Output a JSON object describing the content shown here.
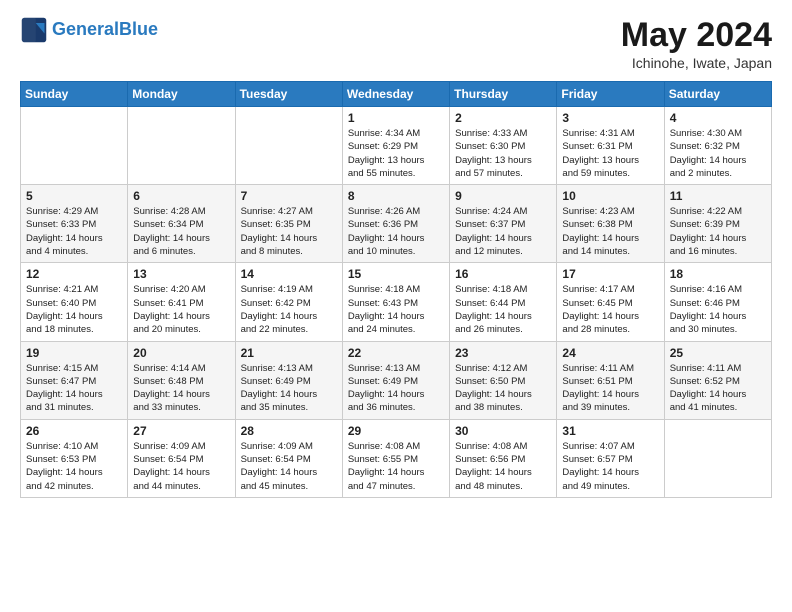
{
  "header": {
    "logo_line1": "General",
    "logo_line2": "Blue",
    "month": "May 2024",
    "location": "Ichinohe, Iwate, Japan"
  },
  "days_of_week": [
    "Sunday",
    "Monday",
    "Tuesday",
    "Wednesday",
    "Thursday",
    "Friday",
    "Saturday"
  ],
  "weeks": [
    [
      {
        "day": "",
        "info": ""
      },
      {
        "day": "",
        "info": ""
      },
      {
        "day": "",
        "info": ""
      },
      {
        "day": "1",
        "info": "Sunrise: 4:34 AM\nSunset: 6:29 PM\nDaylight: 13 hours\nand 55 minutes."
      },
      {
        "day": "2",
        "info": "Sunrise: 4:33 AM\nSunset: 6:30 PM\nDaylight: 13 hours\nand 57 minutes."
      },
      {
        "day": "3",
        "info": "Sunrise: 4:31 AM\nSunset: 6:31 PM\nDaylight: 13 hours\nand 59 minutes."
      },
      {
        "day": "4",
        "info": "Sunrise: 4:30 AM\nSunset: 6:32 PM\nDaylight: 14 hours\nand 2 minutes."
      }
    ],
    [
      {
        "day": "5",
        "info": "Sunrise: 4:29 AM\nSunset: 6:33 PM\nDaylight: 14 hours\nand 4 minutes."
      },
      {
        "day": "6",
        "info": "Sunrise: 4:28 AM\nSunset: 6:34 PM\nDaylight: 14 hours\nand 6 minutes."
      },
      {
        "day": "7",
        "info": "Sunrise: 4:27 AM\nSunset: 6:35 PM\nDaylight: 14 hours\nand 8 minutes."
      },
      {
        "day": "8",
        "info": "Sunrise: 4:26 AM\nSunset: 6:36 PM\nDaylight: 14 hours\nand 10 minutes."
      },
      {
        "day": "9",
        "info": "Sunrise: 4:24 AM\nSunset: 6:37 PM\nDaylight: 14 hours\nand 12 minutes."
      },
      {
        "day": "10",
        "info": "Sunrise: 4:23 AM\nSunset: 6:38 PM\nDaylight: 14 hours\nand 14 minutes."
      },
      {
        "day": "11",
        "info": "Sunrise: 4:22 AM\nSunset: 6:39 PM\nDaylight: 14 hours\nand 16 minutes."
      }
    ],
    [
      {
        "day": "12",
        "info": "Sunrise: 4:21 AM\nSunset: 6:40 PM\nDaylight: 14 hours\nand 18 minutes."
      },
      {
        "day": "13",
        "info": "Sunrise: 4:20 AM\nSunset: 6:41 PM\nDaylight: 14 hours\nand 20 minutes."
      },
      {
        "day": "14",
        "info": "Sunrise: 4:19 AM\nSunset: 6:42 PM\nDaylight: 14 hours\nand 22 minutes."
      },
      {
        "day": "15",
        "info": "Sunrise: 4:18 AM\nSunset: 6:43 PM\nDaylight: 14 hours\nand 24 minutes."
      },
      {
        "day": "16",
        "info": "Sunrise: 4:18 AM\nSunset: 6:44 PM\nDaylight: 14 hours\nand 26 minutes."
      },
      {
        "day": "17",
        "info": "Sunrise: 4:17 AM\nSunset: 6:45 PM\nDaylight: 14 hours\nand 28 minutes."
      },
      {
        "day": "18",
        "info": "Sunrise: 4:16 AM\nSunset: 6:46 PM\nDaylight: 14 hours\nand 30 minutes."
      }
    ],
    [
      {
        "day": "19",
        "info": "Sunrise: 4:15 AM\nSunset: 6:47 PM\nDaylight: 14 hours\nand 31 minutes."
      },
      {
        "day": "20",
        "info": "Sunrise: 4:14 AM\nSunset: 6:48 PM\nDaylight: 14 hours\nand 33 minutes."
      },
      {
        "day": "21",
        "info": "Sunrise: 4:13 AM\nSunset: 6:49 PM\nDaylight: 14 hours\nand 35 minutes."
      },
      {
        "day": "22",
        "info": "Sunrise: 4:13 AM\nSunset: 6:49 PM\nDaylight: 14 hours\nand 36 minutes."
      },
      {
        "day": "23",
        "info": "Sunrise: 4:12 AM\nSunset: 6:50 PM\nDaylight: 14 hours\nand 38 minutes."
      },
      {
        "day": "24",
        "info": "Sunrise: 4:11 AM\nSunset: 6:51 PM\nDaylight: 14 hours\nand 39 minutes."
      },
      {
        "day": "25",
        "info": "Sunrise: 4:11 AM\nSunset: 6:52 PM\nDaylight: 14 hours\nand 41 minutes."
      }
    ],
    [
      {
        "day": "26",
        "info": "Sunrise: 4:10 AM\nSunset: 6:53 PM\nDaylight: 14 hours\nand 42 minutes."
      },
      {
        "day": "27",
        "info": "Sunrise: 4:09 AM\nSunset: 6:54 PM\nDaylight: 14 hours\nand 44 minutes."
      },
      {
        "day": "28",
        "info": "Sunrise: 4:09 AM\nSunset: 6:54 PM\nDaylight: 14 hours\nand 45 minutes."
      },
      {
        "day": "29",
        "info": "Sunrise: 4:08 AM\nSunset: 6:55 PM\nDaylight: 14 hours\nand 47 minutes."
      },
      {
        "day": "30",
        "info": "Sunrise: 4:08 AM\nSunset: 6:56 PM\nDaylight: 14 hours\nand 48 minutes."
      },
      {
        "day": "31",
        "info": "Sunrise: 4:07 AM\nSunset: 6:57 PM\nDaylight: 14 hours\nand 49 minutes."
      },
      {
        "day": "",
        "info": ""
      }
    ]
  ]
}
